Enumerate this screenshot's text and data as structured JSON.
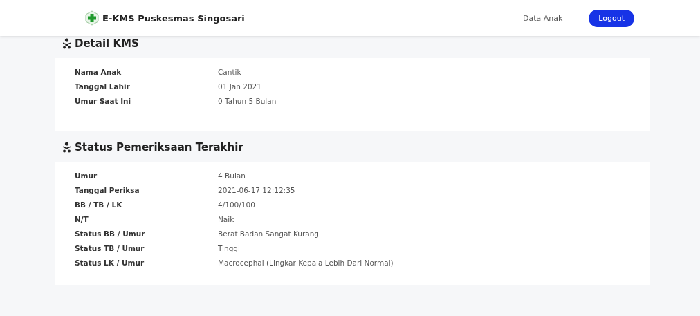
{
  "navbar": {
    "brand": "E-KMS Puskesmas Singosari",
    "links": [
      "Data Anak"
    ],
    "button": "Logout"
  },
  "sections": [
    {
      "title": "Detail KMS",
      "rows": [
        {
          "label": "Nama Anak",
          "value": "Cantik"
        },
        {
          "label": "Tanggal Lahir",
          "value": "01 Jan 2021"
        },
        {
          "label": "Umur Saat Ini",
          "value": "0 Tahun 5 Bulan"
        }
      ]
    },
    {
      "title": "Status Pemeriksaan Terakhir",
      "rows": [
        {
          "label": "Umur",
          "value": "4 Bulan"
        },
        {
          "label": "Tanggal Periksa",
          "value": "2021-06-17 12:12:35"
        },
        {
          "label": "BB / TB / LK",
          "value": "4/100/100"
        },
        {
          "label": "N/T",
          "value": "Naik"
        },
        {
          "label": "Status BB / Umur",
          "value": "Berat Badan Sangat Kurang"
        },
        {
          "label": "Status TB / Umur",
          "value": "Tinggi"
        },
        {
          "label": "Status LK / Umur",
          "value": "Macrocephal (Lingkar Kepala Lebih Dari Normal)"
        }
      ]
    }
  ]
}
